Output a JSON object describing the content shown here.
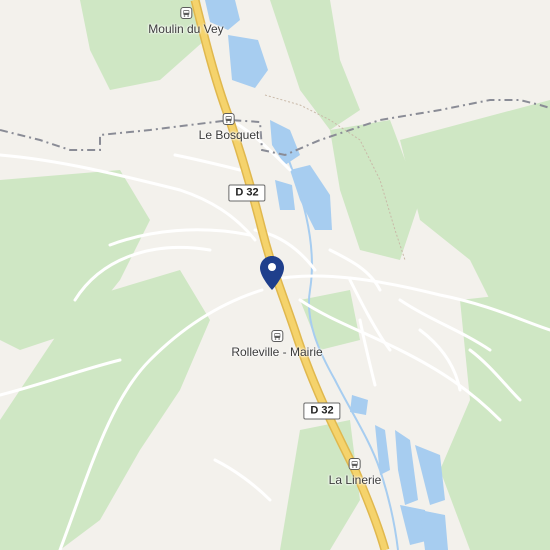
{
  "map": {
    "colors": {
      "background": "#f3f1ec",
      "vegetation": "#cfe7c4",
      "water": "#a7cdf0",
      "road_main": "#f5d36c",
      "road_main_casing": "#e0b84e",
      "road_minor": "#ffffff",
      "boundary": "#8a8c96",
      "pin": "#1f3f8c"
    },
    "places": [
      {
        "id": "moulin",
        "label": "Moulin du Vey",
        "icon": "bus-icon"
      },
      {
        "id": "bosquet",
        "label": "Le Bosquet",
        "icon": "bus-icon"
      },
      {
        "id": "mairie",
        "label": "Rolleville - Mairie",
        "icon": "bus-icon"
      },
      {
        "id": "linerie",
        "label": "La Linerie",
        "icon": "bus-icon"
      }
    ],
    "road_labels": [
      {
        "id": "d32a",
        "label": "D 32"
      },
      {
        "id": "d32b",
        "label": "D 32"
      }
    ],
    "marker": {
      "icon": "location-pin-icon"
    }
  }
}
